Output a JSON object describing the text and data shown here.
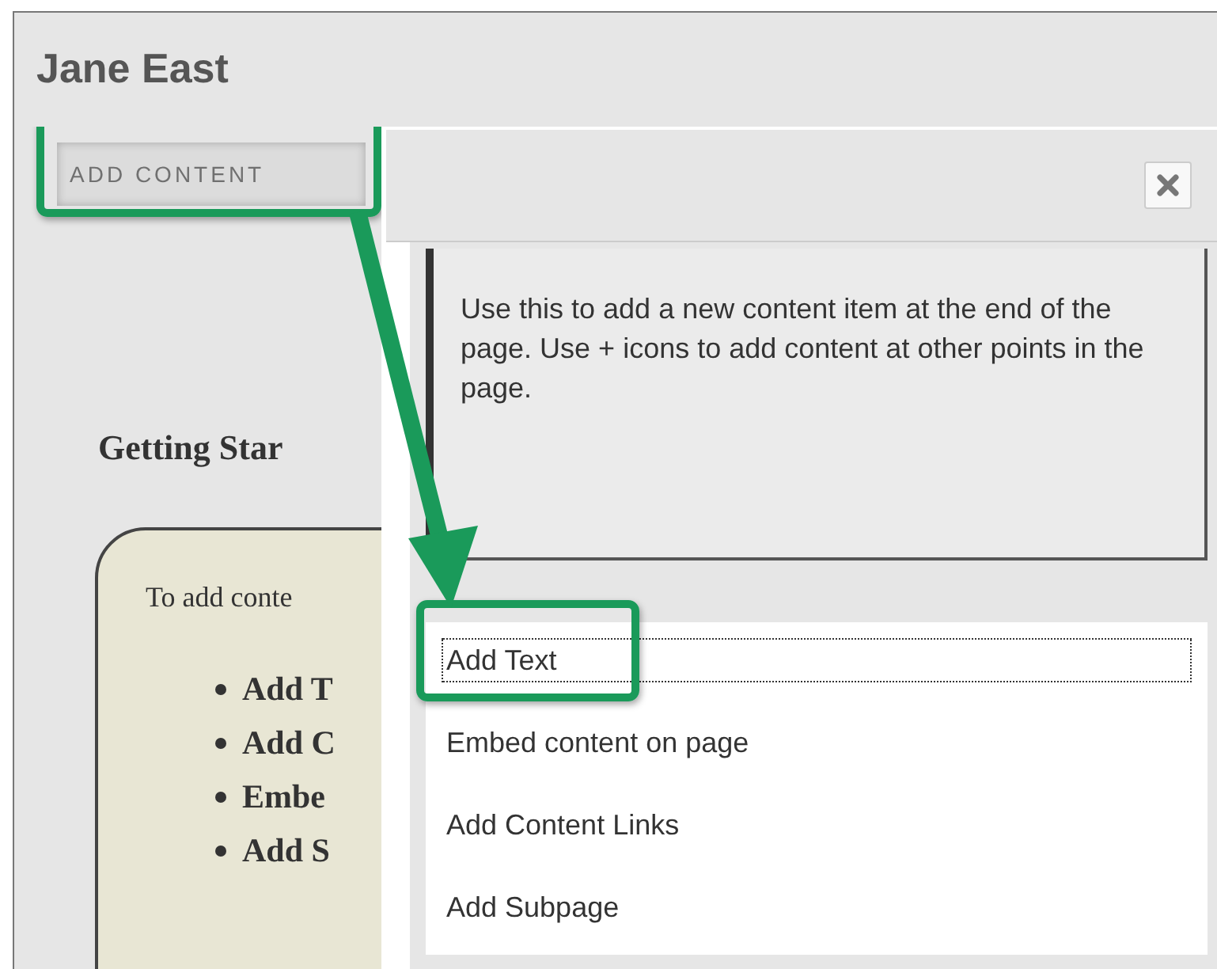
{
  "page_title": "Jane East",
  "add_content_button": {
    "label": "ADD CONTENT",
    "highlighted": true
  },
  "background_page": {
    "heading": "Getting Star",
    "intro": "To add conte",
    "items": [
      "Add T",
      "Add C",
      "Embe",
      "Add S"
    ]
  },
  "dialog": {
    "info": "Use this to add a new content item at the end of the page. Use + icons to add content at other points in the page.",
    "options": [
      {
        "label": "Add Text",
        "selected": true,
        "highlighted": true
      },
      {
        "label": "Embed content on page",
        "selected": false,
        "highlighted": false
      },
      {
        "label": "Add Content Links",
        "selected": false,
        "highlighted": false
      },
      {
        "label": "Add Subpage",
        "selected": false,
        "highlighted": false
      }
    ]
  }
}
